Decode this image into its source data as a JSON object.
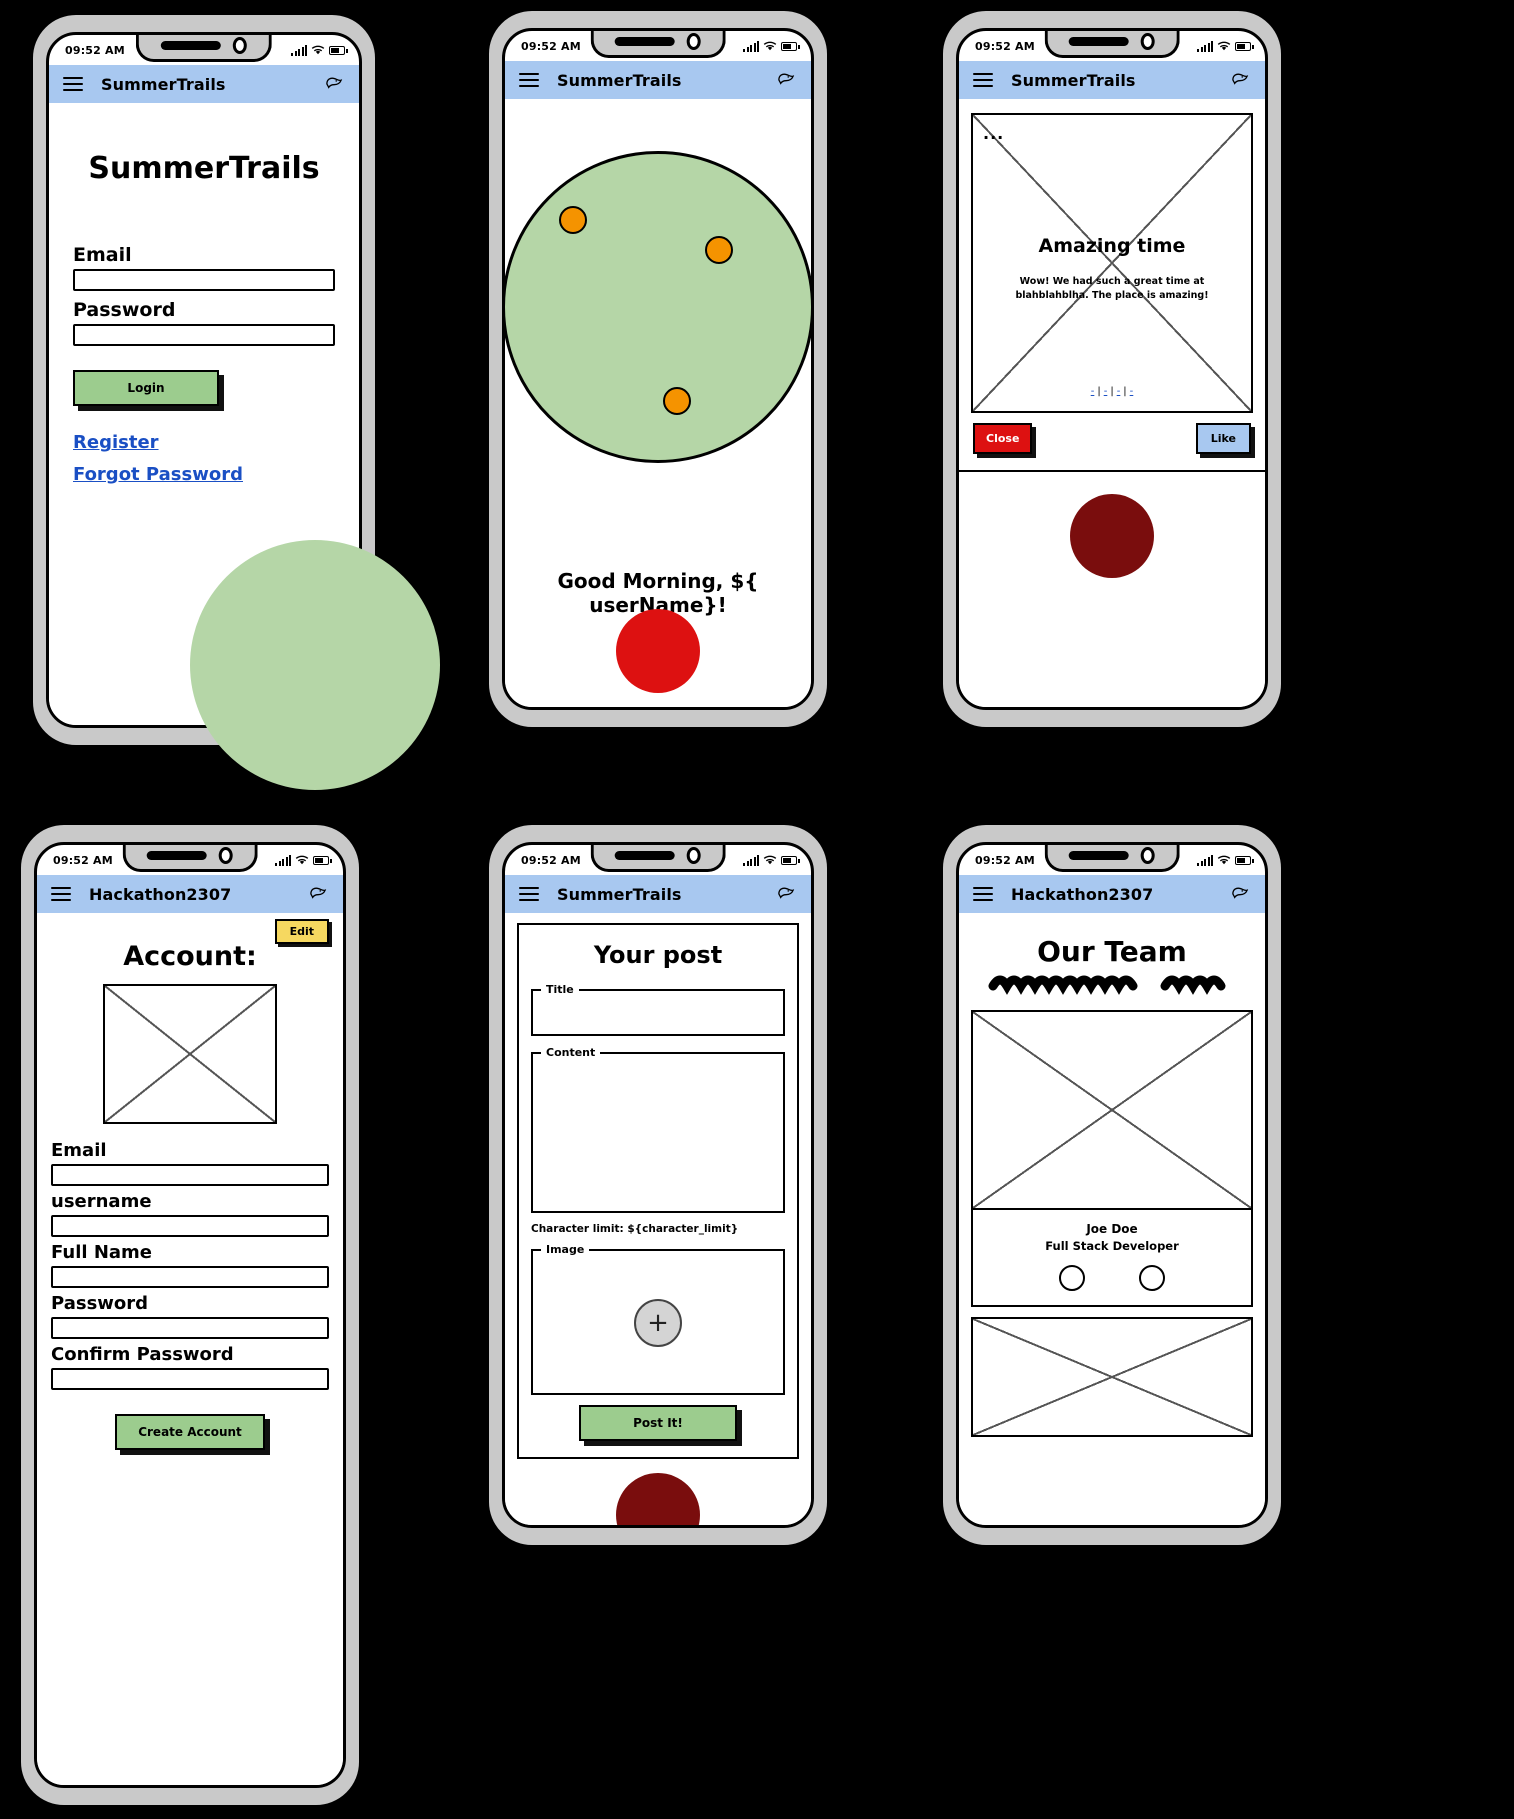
{
  "colors": {
    "appbar": "#a8c8f0",
    "green_button": "#9ccc8e",
    "green_circle": "#b5d6a7",
    "orange_dot": "#f59300",
    "red_circle": "#dd1111",
    "dark_red_circle": "#7a0d0d",
    "link_blue": "#1a4fc4",
    "edit_yellow": "#f6d860"
  },
  "status_bar": {
    "time": "09:52 AM"
  },
  "screens": [
    {
      "id": "login",
      "appbar": {
        "title": "SummerTrails",
        "menu_icon": "hamburger-icon",
        "right_icon": "bird-icon"
      },
      "heading": "SummerTrails",
      "fields": [
        {
          "label": "Email",
          "value": "",
          "placeholder": ""
        },
        {
          "label": "Password",
          "value": "",
          "placeholder": ""
        }
      ],
      "login_button": "Login",
      "links": [
        "Register",
        "Forgot Password"
      ]
    },
    {
      "id": "home",
      "appbar": {
        "title": "SummerTrails",
        "menu_icon": "hamburger-icon",
        "right_icon": "bird-icon"
      },
      "map_dots": 3,
      "greeting": "Good Morning, ${ userName}!"
    },
    {
      "id": "post-detail",
      "appbar": {
        "title": "SummerTrails",
        "menu_icon": "hamburger-icon",
        "right_icon": "bird-icon"
      },
      "overflow": "...",
      "post_title": "Amazing time",
      "post_body": "Wow! We had such a great time at blahblahblha. The place is amazing!",
      "mini_links": [
        "-",
        "-",
        "-",
        "-"
      ],
      "close_button": "Close",
      "like_button": "Like"
    },
    {
      "id": "account",
      "appbar": {
        "title": "Hackathon2307",
        "menu_icon": "hamburger-icon",
        "right_icon": "bird-icon"
      },
      "edit_button": "Edit",
      "heading": "Account:",
      "fields": [
        {
          "label": "Email",
          "value": ""
        },
        {
          "label": "username",
          "value": ""
        },
        {
          "label": "Full Name",
          "value": ""
        },
        {
          "label": "Password",
          "value": ""
        },
        {
          "label": "Confirm Password",
          "value": ""
        }
      ],
      "create_button": "Create Account"
    },
    {
      "id": "new-post",
      "appbar": {
        "title": "SummerTrails",
        "menu_icon": "hamburger-icon",
        "right_icon": "bird-icon"
      },
      "heading": "Your post",
      "title_legend": "Title",
      "title_value": "",
      "content_legend": "Content",
      "content_value": "",
      "char_limit": "Character limit: ${character_limit}",
      "image_legend": "Image",
      "add_image_icon": "plus-icon",
      "post_button": "Post It!"
    },
    {
      "id": "our-team",
      "appbar": {
        "title": "Hackathon2307",
        "menu_icon": "hamburger-icon",
        "right_icon": "bird-icon"
      },
      "heading": "Our Team",
      "member_name": "Joe Doe",
      "member_role": "Full Stack Developer"
    }
  ]
}
